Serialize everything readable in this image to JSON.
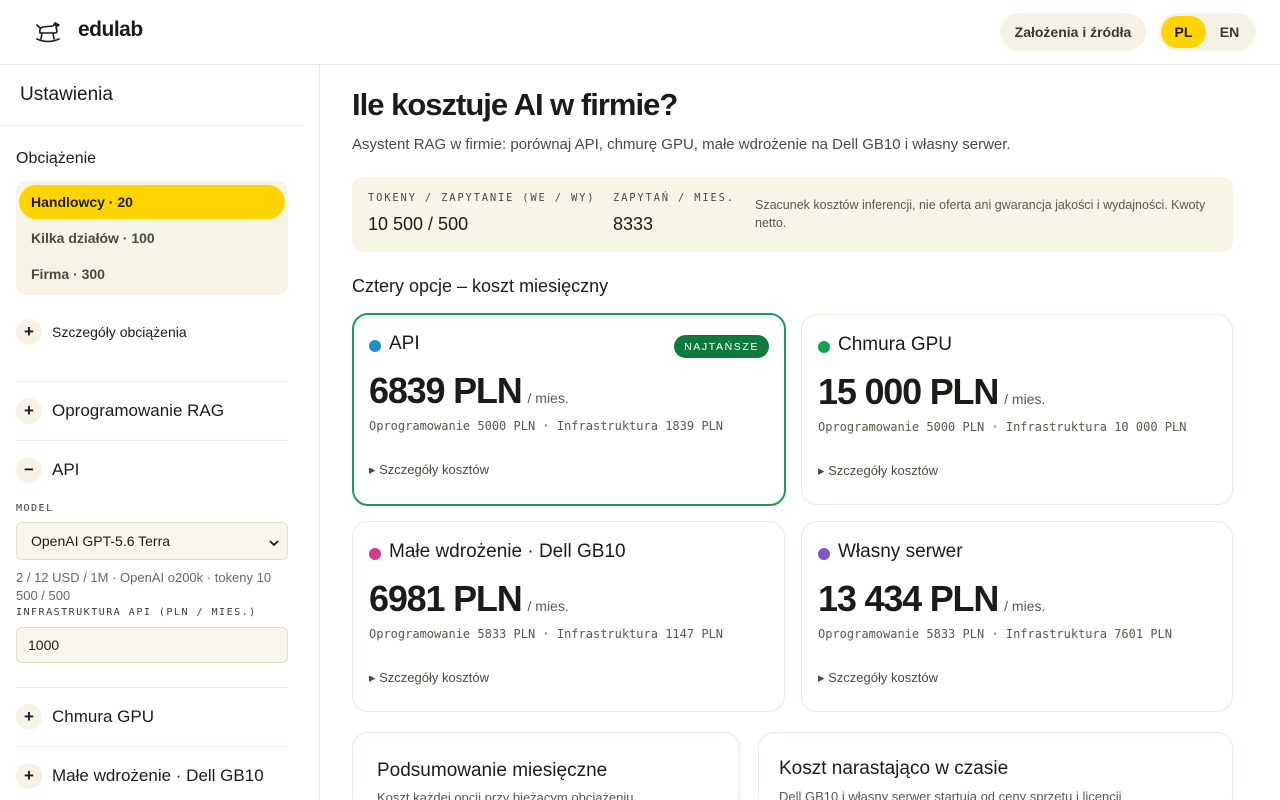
{
  "header": {
    "logo_text": "edulab",
    "logo_icon": "rocking-horse-icon",
    "assumptions_button": "Założenia i źródła",
    "languages": [
      "PL",
      "EN"
    ],
    "active_language": "PL"
  },
  "sidebar": {
    "title": "Ustawienia",
    "load_label": "Obciążenie",
    "load_options": [
      "Handlowcy · 20",
      "Kilka działów · 100",
      "Firma · 300"
    ],
    "load_active": "Handlowcy · 20",
    "load_details": "Szczegóły obciążenia",
    "sections": {
      "rag": "Oprogramowanie RAG",
      "api": "API",
      "gpu": "Chmura GPU",
      "gb10": "Małe wdrożenie · Dell GB10"
    },
    "api": {
      "model_label": "MODEL",
      "model_value": "OpenAI GPT-5.6 Terra",
      "model_info": "2 / 12 USD / 1M · OpenAI o200k · tokeny 10 500 / 500",
      "infra_label": "INFRASTRUKTURA API (PLN / MIES.)",
      "infra_value": "1000"
    }
  },
  "main": {
    "title": "Ile kosztuje AI w firmie?",
    "subtitle": "Asystent RAG w firmie: porównaj API, chmurę GPU, małe wdrożenie na Dell GB10 i własny serwer.",
    "stats": {
      "tokens_label": "TOKENY / ZAPYTANIE (WE / WY)",
      "tokens_value": "10 500 / 500",
      "queries_label": "ZAPYTAŃ / MIES.",
      "queries_value": "8333",
      "note": "Szacunek kosztów inferencji, nie oferta ani gwarancja jakości i wydajności. Kwoty netto."
    },
    "options_heading": "Cztery opcje – koszt miesięczny",
    "per_month": "/ mies.",
    "details_label": "Szczegóły kosztów",
    "badge_cheapest": "NAJTAŃSZE",
    "cards": [
      {
        "name": "API",
        "price": "6839 PLN",
        "breakdown": "Oprogramowanie 5000 PLN · Infrastruktura 1839 PLN",
        "color": "#1f8fc8"
      },
      {
        "name": "Chmura GPU",
        "price": "15 000 PLN",
        "breakdown": "Oprogramowanie 5000 PLN · Infrastruktura 10 000 PLN",
        "color": "#13a050"
      },
      {
        "name": "Małe wdrożenie · Dell GB10",
        "price": "6981 PLN",
        "breakdown": "Oprogramowanie 5833 PLN · Infrastruktura 1147 PLN",
        "color": "#cc3d8a"
      },
      {
        "name": "Własny serwer",
        "price": "13 434 PLN",
        "breakdown": "Oprogramowanie 5833 PLN · Infrastruktura 7601 PLN",
        "color": "#7e55c9"
      }
    ],
    "summary": {
      "title": "Podsumowanie miesięczne",
      "subtitle": "Koszt każdej opcji przy bieżącym obciążeniu"
    },
    "cumulative": {
      "title": "Koszt narastająco w czasie",
      "subtitle": "Dell GB10 i własny serwer startują od ceny sprzętu i licencji"
    }
  }
}
